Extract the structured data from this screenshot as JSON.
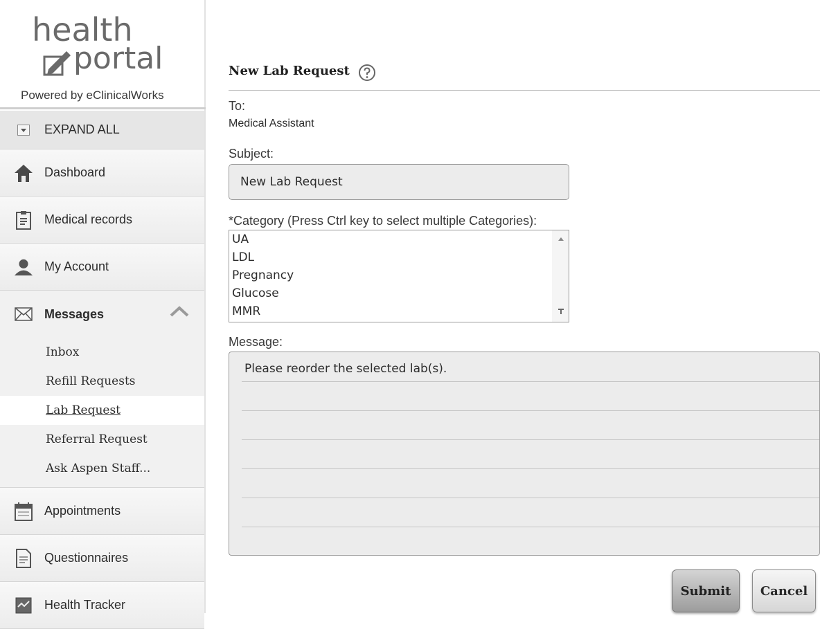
{
  "logo": {
    "line1": "health",
    "line2": "portal"
  },
  "powered_by": "Powered by eClinicalWorks",
  "sidebar": {
    "expand_all": "EXPAND ALL",
    "items": [
      {
        "label": "Dashboard",
        "icon": "home-icon"
      },
      {
        "label": "Medical records",
        "icon": "clipboard-icon"
      },
      {
        "label": "My Account",
        "icon": "user-icon"
      },
      {
        "label": "Messages",
        "icon": "envelope-icon"
      },
      {
        "label": "Appointments",
        "icon": "calendar-icon"
      },
      {
        "label": "Questionnaires",
        "icon": "document-icon"
      },
      {
        "label": "Health Tracker",
        "icon": "tracker-icon"
      }
    ],
    "messages_sub": [
      "Inbox",
      "Refill Requests",
      "Lab Request",
      "Referral Request",
      "Ask Aspen Staff..."
    ],
    "active_sub": "Lab Request"
  },
  "form": {
    "title": "New Lab Request",
    "to_label": "To:",
    "to_value": "Medical Assistant",
    "subject_label": "Subject:",
    "subject_value": "New Lab Request",
    "category_label": "*Category (Press Ctrl key to select multiple Categories):",
    "categories": [
      "UA",
      "LDL",
      "Pregnancy",
      "Glucose",
      "MMR"
    ],
    "message_label": "Message:",
    "message_value": "Please reorder the selected lab(s).",
    "submit_label": "Submit",
    "cancel_label": "Cancel"
  },
  "colors": {
    "sidebar_bg": "#f0f0f0",
    "field_bg": "#ececec",
    "submit_bg": "#b0b0b0"
  }
}
